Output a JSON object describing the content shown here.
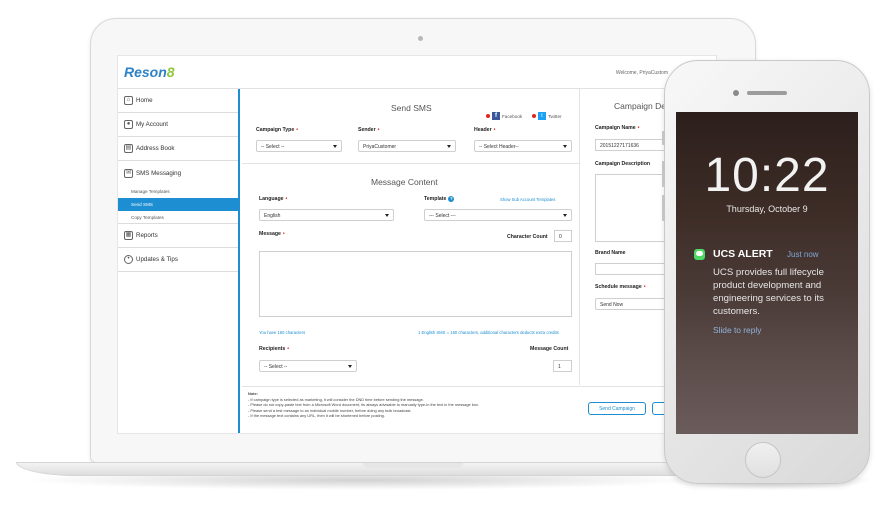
{
  "app": {
    "logo_text": "Reson",
    "logo_accent": "8",
    "welcome": "Welcome, PriyaCustom",
    "brand_color": "#1c8ed1"
  },
  "sidebar": {
    "items": [
      {
        "label": "Home",
        "icon": "home-icon"
      },
      {
        "label": "My Account",
        "icon": "user-icon"
      },
      {
        "label": "Address Book",
        "icon": "address-book-icon"
      },
      {
        "label": "SMS Messaging",
        "icon": "envelope-icon"
      },
      {
        "label": "Reports",
        "icon": "report-icon"
      },
      {
        "label": "Updates & Tips",
        "icon": "bulb-icon"
      }
    ],
    "sub_items": [
      "Manage Templates",
      "Send SMS",
      "Copy Templates"
    ],
    "active_sub": "Send SMS"
  },
  "send_sms": {
    "title": "Send SMS",
    "facebook": "Facebook",
    "twitter": "Twitter",
    "campaign_type_label": "Campaign Type",
    "campaign_type_value": "-- Select --",
    "sender_label": "Sender",
    "sender_value": "PriyaCustomer",
    "header_label": "Header",
    "header_value": "-- Select Header--"
  },
  "message_content": {
    "title": "Message Content",
    "language_label": "Language",
    "language_value": "English",
    "template_label": "Template",
    "template_value": "--- Select ---",
    "sub_account_link": "Show Sub Account Templates",
    "message_label": "Message",
    "char_count_label": "Character Count",
    "char_count_value": "0",
    "hint_left": "You have 160 characters",
    "hint_right": "1 English SMS = 160 characters, additional characters deducts extra credits",
    "recipients_label": "Recipients",
    "recipients_value": "-- Select --",
    "message_count_label": "Message Count",
    "message_count_value": "1"
  },
  "campaign_details": {
    "title": "Campaign De",
    "campaign_name_label": "Campaign Name",
    "campaign_name_value": "20151227171636",
    "campaign_description_label": "Campaign Description",
    "brand_name_label": "Brand Name",
    "schedule_label": "Schedule message",
    "schedule_value": "Send Now"
  },
  "notes": {
    "heading": "Note:",
    "lines": [
      "- If campaign type is selected as marketing, it will consider the DND time before sending the message.",
      "- Please do not copy-paste text from a Microsoft Word document, its always advisable to manually type-in the text in the message box.",
      "- Please send a test message to an individual mobile number, before doing any bulk broadcast.",
      "- If the message text contains any URL, then it will be shortened before posting."
    ]
  },
  "buttons": {
    "send_campaign": "Send Campaign"
  },
  "phone": {
    "time": "10:22",
    "date": "Thursday, October 9",
    "notif_title": "UCS ALERT",
    "notif_time": "Just now",
    "notif_body": "UCS provides full lifecycle product development and engineering services to its customers.",
    "notif_action": "Slide to reply"
  }
}
